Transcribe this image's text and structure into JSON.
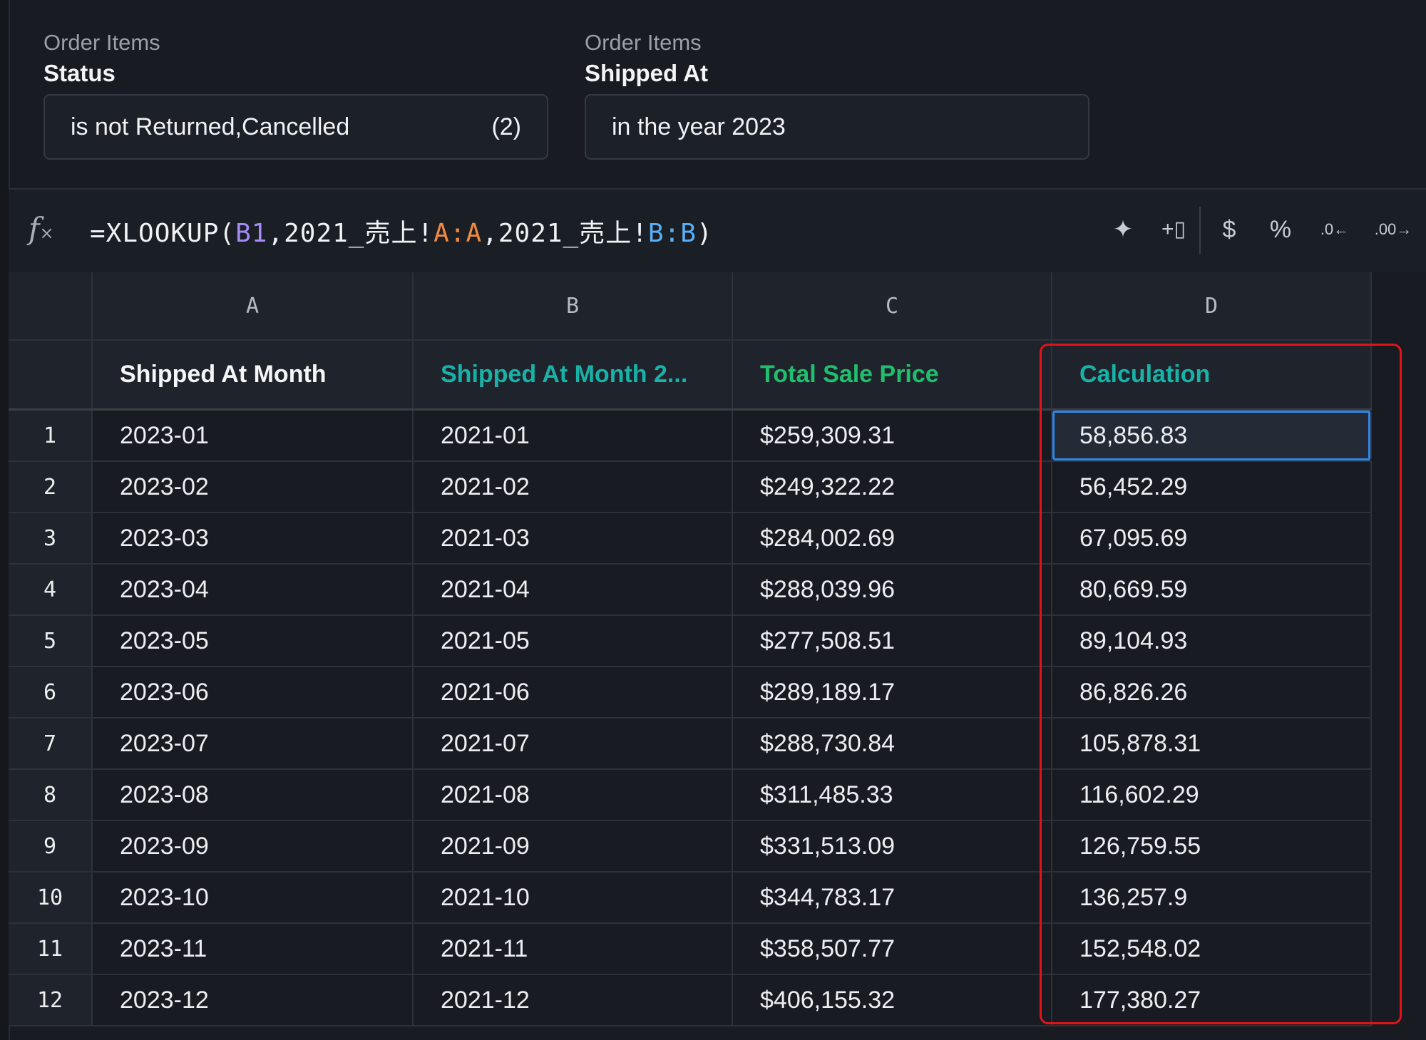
{
  "filters": [
    {
      "category": "Order Items",
      "field": "Status",
      "value": "is not Returned,Cancelled",
      "count": "(2)"
    },
    {
      "category": "Order Items",
      "field": "Shipped At",
      "value": "in the year 2023",
      "count": ""
    }
  ],
  "formula_bar": {
    "fx_icon": "function-icon",
    "formula_parts": [
      "=XLOOKUP(",
      "B1",
      ",2021_売上!",
      "A:A",
      ",2021_売上!",
      "B:B",
      ")"
    ],
    "tools": [
      {
        "icon": "sparkle-icon",
        "glyph": "✦"
      },
      {
        "icon": "insert-column-icon",
        "glyph": "+▯"
      },
      {
        "icon": "currency-format-icon",
        "glyph": "$"
      },
      {
        "icon": "percent-format-icon",
        "glyph": "%"
      },
      {
        "icon": "decrease-decimal-icon",
        "glyph": ".0←"
      },
      {
        "icon": "increase-decimal-icon",
        "glyph": ".00→"
      }
    ]
  },
  "grid": {
    "column_letters": [
      "A",
      "B",
      "C",
      "D"
    ],
    "field_headers": [
      "Shipped At Month",
      "Shipped At Month 2...",
      "Total Sale Price",
      "Calculation"
    ],
    "header_colors": {
      "white": "#f5f6f7",
      "teal": "#17b2a8",
      "green": "#1fbf6e"
    },
    "rows": [
      {
        "n": "1",
        "a": "2023-01",
        "b": "2021-01",
        "c": "$259,309.31",
        "d": "58,856.83"
      },
      {
        "n": "2",
        "a": "2023-02",
        "b": "2021-02",
        "c": "$249,322.22",
        "d": "56,452.29"
      },
      {
        "n": "3",
        "a": "2023-03",
        "b": "2021-03",
        "c": "$284,002.69",
        "d": "67,095.69"
      },
      {
        "n": "4",
        "a": "2023-04",
        "b": "2021-04",
        "c": "$288,039.96",
        "d": "80,669.59"
      },
      {
        "n": "5",
        "a": "2023-05",
        "b": "2021-05",
        "c": "$277,508.51",
        "d": "89,104.93"
      },
      {
        "n": "6",
        "a": "2023-06",
        "b": "2021-06",
        "c": "$289,189.17",
        "d": "86,826.26"
      },
      {
        "n": "7",
        "a": "2023-07",
        "b": "2021-07",
        "c": "$288,730.84",
        "d": "105,878.31"
      },
      {
        "n": "8",
        "a": "2023-08",
        "b": "2021-08",
        "c": "$311,485.33",
        "d": "116,602.29"
      },
      {
        "n": "9",
        "a": "2023-09",
        "b": "2021-09",
        "c": "$331,513.09",
        "d": "126,759.55"
      },
      {
        "n": "10",
        "a": "2023-10",
        "b": "2021-10",
        "c": "$344,783.17",
        "d": "136,257.9"
      },
      {
        "n": "11",
        "a": "2023-11",
        "b": "2021-11",
        "c": "$358,507.77",
        "d": "152,548.02"
      },
      {
        "n": "12",
        "a": "2023-12",
        "b": "2021-12",
        "c": "$406,155.32",
        "d": "177,380.27"
      }
    ],
    "selected_cell": "D1",
    "selection_color": "#2e86ec",
    "annotation_color": "#e0141a"
  }
}
